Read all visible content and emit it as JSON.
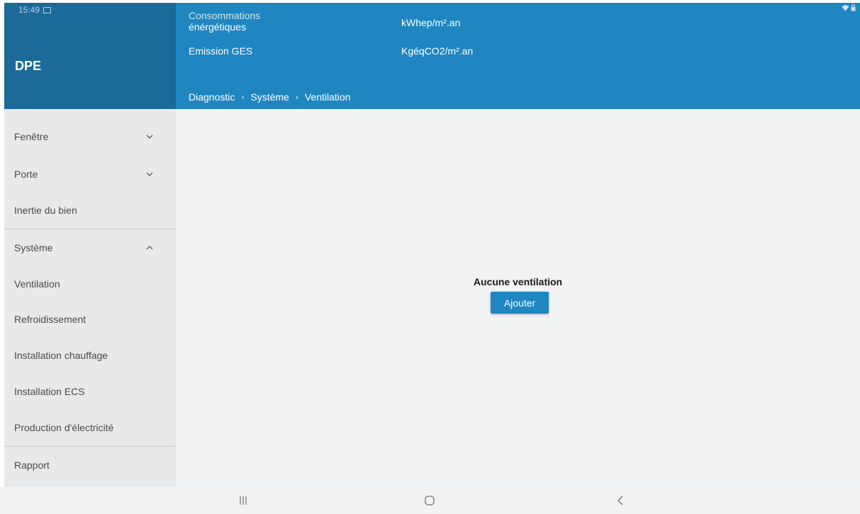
{
  "status_bar": {
    "time": "15:49"
  },
  "app": {
    "title": "DPE"
  },
  "header": {
    "consommations_label_line1": "Consommations",
    "consommations_label_line2": "énérgétiques",
    "consommations_unit": "kWhep/m².an",
    "ges_label": "Emission GES",
    "ges_unit": "KgéqCO2/m².an"
  },
  "breadcrumb": [
    "Diagnostic",
    "Système",
    "Ventilation"
  ],
  "sidebar": {
    "items": [
      {
        "label": "Fenêtre",
        "chevron": "down"
      },
      {
        "label": "Porte",
        "chevron": "down"
      },
      {
        "label": "Inertie du bien"
      },
      {
        "label": "Système",
        "chevron": "up"
      },
      {
        "label": "Ventilation"
      },
      {
        "label": "Refroidissement"
      },
      {
        "label": "Installation chauffage"
      },
      {
        "label": "Installation ECS"
      },
      {
        "label": "Production d'électricité"
      },
      {
        "label": "Rapport"
      }
    ]
  },
  "main": {
    "empty_text": "Aucune ventilation",
    "add_button": "Ajouter"
  },
  "colors": {
    "header_dark": "#1c6a99",
    "header_blue": "#1f86c1",
    "sidebar_bg": "#e8e9eb",
    "content_bg": "#f1f3f5"
  }
}
